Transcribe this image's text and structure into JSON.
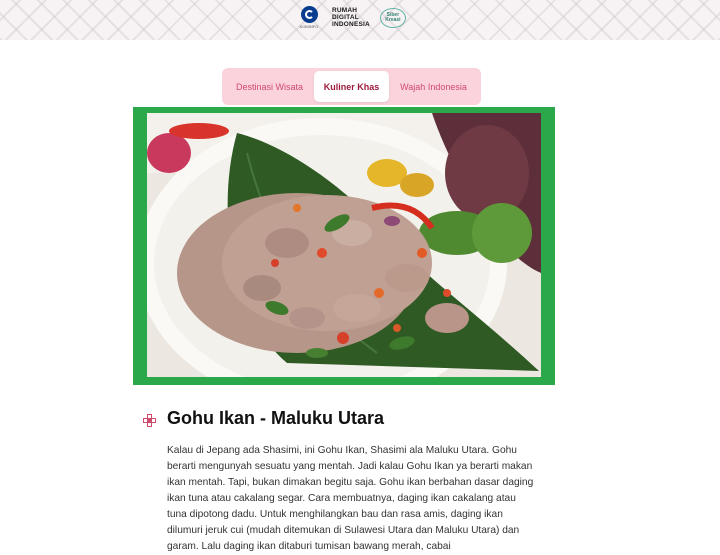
{
  "header": {
    "logos": [
      {
        "name": "kominfo-logo",
        "label": "KOMINFO"
      },
      {
        "name": "rumah-digital-indonesia-logo",
        "lines": [
          "RUMAH",
          "DIGITAL",
          "INDONESIA"
        ]
      },
      {
        "name": "siberkreasi-badge",
        "label": "Siber Kreasi"
      }
    ]
  },
  "tabs": [
    {
      "label": "Destinasi Wisata",
      "active": false
    },
    {
      "label": "Kuliner Khas",
      "active": true
    },
    {
      "label": "Wajah Indonesia",
      "active": false
    }
  ],
  "colors": {
    "tab_bar": "#fad3dc",
    "tab_text": "#d24a6e",
    "tab_active_text": "#9e1b3e",
    "image_frame": "#2aa84a",
    "ornament_icon": "#d24a6e"
  },
  "article": {
    "icon": "ornament-icon",
    "title": "Gohu Ikan - Maluku Utara",
    "body": "Kalau di Jepang ada Shasimi, ini Gohu Ikan, Shasimi ala Maluku Utara. Gohu berarti mengunyah sesuatu yang mentah. Jadi kalau Gohu Ikan ya berarti makan ikan mentah. Tapi, bukan dimakan begitu saja. Gohu ikan berbahan dasar daging ikan tuna atau cakalang segar. Cara membuatnya, daging ikan cakalang atau tuna dipotong dadu. Untuk menghilangkan bau dan rasa amis, daging ikan dilumuri jeruk cui (mudah ditemukan di Sulawesi Utara dan Maluku Utara) dan garam. Lalu daging ikan ditaburi tumisan bawang merah, cabai"
  }
}
